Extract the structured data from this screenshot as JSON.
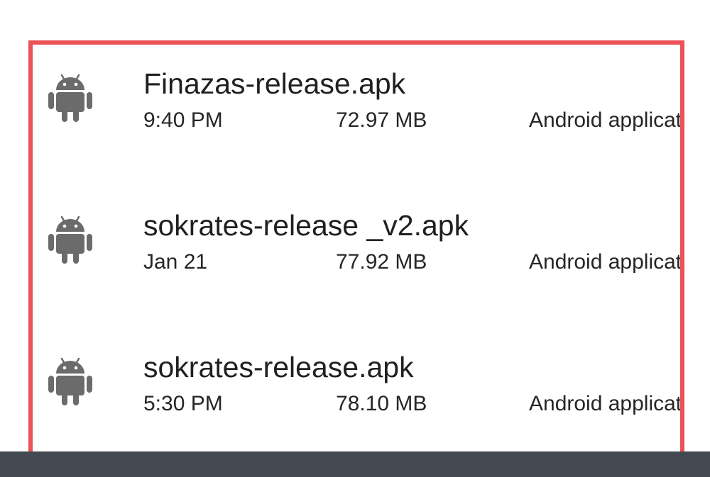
{
  "files": [
    {
      "name": "Finazas-release.apk",
      "date": "9:40 PM",
      "size": "72.97 MB",
      "type": "Android application",
      "icon": "android-icon"
    },
    {
      "name": "sokrates-release _v2.apk",
      "date": "Jan 21",
      "size": "77.92 MB",
      "type": "Android application",
      "icon": "android-icon"
    },
    {
      "name": "sokrates-release.apk",
      "date": "5:30 PM",
      "size": "78.10 MB",
      "type": "Android application",
      "icon": "android-icon"
    }
  ],
  "colors": {
    "icon": "#6b6b6b",
    "highlight_border": "#ec5156",
    "bottom_bar": "#424950",
    "background": "#ffffff"
  }
}
